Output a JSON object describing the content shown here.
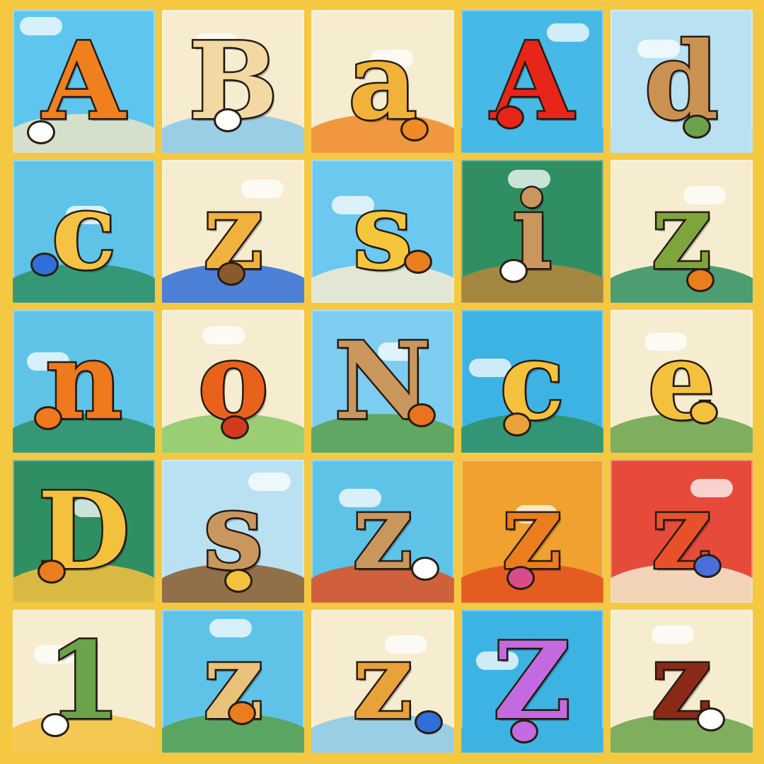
{
  "tiles": [
    {
      "letter": "A",
      "color": "#f07f1e",
      "bg": "#5ec6ee",
      "hill": "#e9e3c6",
      "critter": "#ffffff"
    },
    {
      "letter": "B",
      "color": "#f2d8a2",
      "bg": "#f6eccf",
      "hill": "#8ac9e8",
      "critter": "#ffffff"
    },
    {
      "letter": "a",
      "color": "#f1b23a",
      "bg": "#f6eccf",
      "hill": "#f08a24",
      "critter": "#f08a24"
    },
    {
      "letter": "A",
      "color": "#e7251a",
      "bg": "#46b9e6",
      "hill": "#46b9e6",
      "critter": "#e7251a"
    },
    {
      "letter": "d",
      "color": "#c99253",
      "bg": "#b9e1f2",
      "hill": "#b9e1f2",
      "critter": "#6aa34b"
    },
    {
      "letter": "c",
      "color": "#f4c244",
      "bg": "#5fc3e8",
      "hill": "#2f8f63",
      "critter": "#2f6fd8"
    },
    {
      "letter": "z",
      "color": "#f0b23c",
      "bg": "#f6eccf",
      "hill": "#2f6fd8",
      "critter": "#8a5a2c"
    },
    {
      "letter": "s",
      "color": "#f3c63c",
      "bg": "#6cc8ee",
      "hill": "#f6eccf",
      "critter": "#ea7d1e"
    },
    {
      "letter": "i",
      "color": "#c9975e",
      "bg": "#2f8f63",
      "hill": "#b8863a",
      "critter": "#ffffff"
    },
    {
      "letter": "z",
      "color": "#7da53b",
      "bg": "#f6eccf",
      "hill": "#2f8f63",
      "critter": "#ea7d1e"
    },
    {
      "letter": "n",
      "color": "#ee7a1d",
      "bg": "#5fc3e8",
      "hill": "#2f8f63",
      "critter": "#ee7a1d"
    },
    {
      "letter": "o",
      "color": "#e9621c",
      "bg": "#f6eccf",
      "hill": "#8ac965",
      "critter": "#d33b1e"
    },
    {
      "letter": "N",
      "color": "#c9975e",
      "bg": "#7ccdf0",
      "hill": "#5aa04a",
      "critter": "#e9741e"
    },
    {
      "letter": "c",
      "color": "#f4c13d",
      "bg": "#3db3e3",
      "hill": "#2f8f63",
      "critter": "#e9a13a"
    },
    {
      "letter": "e",
      "color": "#f4c13d",
      "bg": "#f6eccf",
      "hill": "#6aa34b",
      "critter": "#f4c13d"
    },
    {
      "letter": "D",
      "color": "#f4c13d",
      "bg": "#2f8f63",
      "hill": "#f4c13d",
      "critter": "#ea7d1e"
    },
    {
      "letter": "s",
      "color": "#c9975e",
      "bg": "#b9e1f2",
      "hill": "#8a5a2c",
      "critter": "#f4c13d"
    },
    {
      "letter": "z",
      "color": "#c9975e",
      "bg": "#5fc3e8",
      "hill": "#e2501d",
      "critter": "#ffffff"
    },
    {
      "letter": "z",
      "color": "#ea7d1e",
      "bg": "#f0a12f",
      "hill": "#e2501d",
      "critter": "#d94c8a"
    },
    {
      "letter": "z",
      "color": "#e7512a",
      "bg": "#e54a3a",
      "hill": "#f6eccf",
      "critter": "#4a6fd8"
    },
    {
      "letter": "1",
      "color": "#6aa34b",
      "bg": "#f6eccf",
      "hill": "#f4c13d",
      "critter": "#ffffff"
    },
    {
      "letter": "z",
      "color": "#e9c27a",
      "bg": "#5fc3e8",
      "hill": "#5aa04a",
      "critter": "#ea7d1e"
    },
    {
      "letter": "z",
      "color": "#e9a13a",
      "bg": "#f6eccf",
      "hill": "#8ac9e8",
      "critter": "#2f6fd8"
    },
    {
      "letter": "Z",
      "color": "#c46ae0",
      "bg": "#3db3e3",
      "hill": "#3db3e3",
      "critter": "#c46ae0"
    },
    {
      "letter": "z",
      "color": "#8b2a16",
      "bg": "#f6eccf",
      "hill": "#6aa34b",
      "critter": "#ffffff"
    }
  ]
}
